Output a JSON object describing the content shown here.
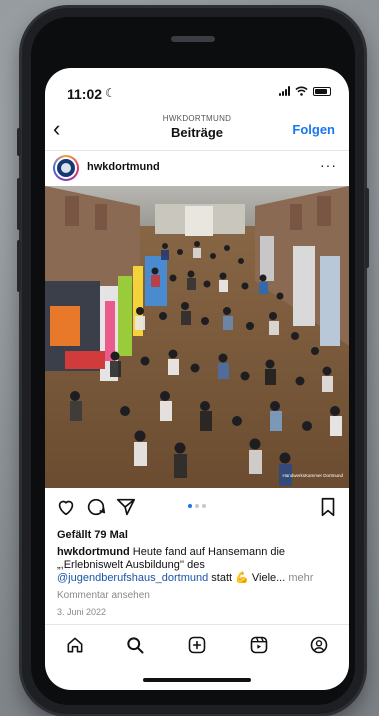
{
  "status_bar": {
    "time": "11:02"
  },
  "header": {
    "account": "HWKDORTMUND",
    "title": "Beiträge",
    "follow_label": "Folgen"
  },
  "post": {
    "username": "hwkdortmund",
    "more_label": "···",
    "photo_watermark": "HandwerksKammer Dortmund",
    "likes": "Gefällt 79 Mal",
    "caption_user": "hwkdortmund",
    "caption_text_1": " Heute fand auf Hansemann die „,Erlebniswelt Ausbildung'' des ",
    "caption_mention": "@jugendberufshaus_dortmund",
    "caption_text_2": " statt 💪 Viele... ",
    "caption_more": "mehr",
    "comments_link": "Kommentar ansehen",
    "date": "3. Juni 2022"
  },
  "carousel": {
    "count": 3,
    "active": 1
  },
  "icons": {
    "like": "heart-icon",
    "comment": "comment-icon",
    "share": "paper-plane-icon",
    "save": "bookmark-icon",
    "nav": [
      "home-icon",
      "search-icon",
      "add-post-icon",
      "reels-icon",
      "profile-icon"
    ]
  },
  "colors": {
    "link": "#1877f2",
    "mention": "#1a55a8",
    "muted": "#8a8a8a"
  }
}
